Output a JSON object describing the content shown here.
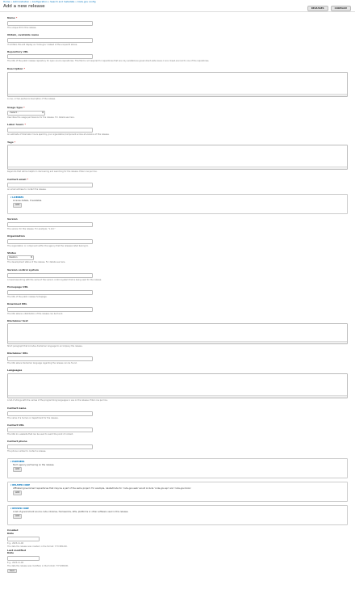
{
  "breadcrumb": "Home » Administration » Configuration » Search and metadata » Code.gov config",
  "page_title": "Add a new release",
  "actions": {
    "button_1": "RELEASES",
    "button_2": "CODEGOV"
  },
  "fields": {
    "name": {
      "label": "Name",
      "req": "*",
      "desc": "The unique ID for this release."
    },
    "vcs_id": {
      "label": "Obtain, available name",
      "desc": "If omitted, this will display an 'Code.gov' instead of the unique ID above."
    },
    "repo_url": {
      "label": "Repository URL",
      "desc": "The URL of the public release repository for open source repositories. This field is not required for repositories that are only available as government-wide reuse or are closed-sourced to one of the repositories."
    },
    "description": {
      "label": "Description",
      "req": "*",
      "desc": "A one- or two-sentence description of the release."
    },
    "usage_type": {
      "label": "Usage type",
      "req": "*",
      "value": "- Select -",
      "desc": "Describes the usage permissions for the release. For details see here."
    },
    "labor_hours": {
      "label": "Labor hours",
      "req": "*",
      "desc": "An estimate of total labor hours spent by your organization/component across all versions of this release."
    },
    "tags": {
      "label": "Tags",
      "req": "*",
      "desc": "Keywords that will be helpful in discovering and searching for the release. Enter one per line."
    },
    "contact_email": {
      "label": "Contact email",
      "req": "*",
      "desc": "An email address to contact the release."
    },
    "version": {
      "label": "Version",
      "desc": "The version for this release. For example, \"1.0.0.\""
    },
    "organization": {
      "label": "Organization",
      "desc": "The organization or component within the agency that the releases listed belong to."
    },
    "status": {
      "label": "Status",
      "value": "Ideation",
      "desc": "The development status of the release. For details see here."
    },
    "vcs": {
      "label": "Version control system",
      "desc": "A lowercase string with the name of the version control system that is being used for the release."
    },
    "homepage_url": {
      "label": "Homepage URL",
      "desc": "The URL of the public release homepage."
    },
    "download_url": {
      "label": "Download URL",
      "desc": "The URL where a distribution of the release can be found."
    },
    "disclaimer_text": {
      "label": "Disclaimer text",
      "desc": "Short paragraph that includes disclaimer language to accompany the release."
    },
    "disclaimer_url": {
      "label": "Disclaimer URL",
      "desc": "The URL where disclaimer language regarding the release can be found."
    },
    "languages": {
      "label": "Languages",
      "desc": "A list of strings with the names of the programming languages in use on the release. Enter one per line."
    },
    "contact_name": {
      "label": "Contact name",
      "desc": "The name of a human or department for the release."
    },
    "contact_url": {
      "label": "Contact URL",
      "desc": "The URL to a website that can be used to reach the point of contact."
    },
    "contact_phone": {
      "label": "Contact phone",
      "desc": "The phone number to contact a release."
    }
  },
  "fieldsets": {
    "licenses": {
      "legend": "LICENSES",
      "text": "License details, if available.",
      "button": "ADD"
    },
    "partners": {
      "legend": "PARTNERS",
      "text": "Each agency partnering on the release.",
      "button": "ADD"
    },
    "related_code": {
      "legend": "RELATED CODE",
      "text": "Affiliated government repositories that may be a part of the same project. For example, relatedCode for 'code-gov-web' would include 'code-gov-api' and 'code-gov-tools'.",
      "button": "ADD"
    },
    "reused_code": {
      "legend": "REUSED CODE",
      "text": "A list of government source code, libraries, frameworks, APIs, platforms or other software used in this release.",
      "button": "ADD"
    }
  },
  "dates": {
    "section": "Created",
    "created_label": "Date",
    "created_hint": "E.g., 2023-11-06",
    "created_desc": "The date the release was created, in the format: YYYY-MM-DD.",
    "modified_section": "Last modified",
    "modified_label": "Date",
    "modified_hint": "E.g., 2023-11-06",
    "modified_desc": "The date the release was modified, in the format: YYYY-MM-DD."
  },
  "save_label": "Save",
  "colors": {
    "link": "#0074bd",
    "required": "#cc0000"
  },
  "icons": {
    "select_arrow": "chevron-down-icon",
    "textarea_grip": "resize-grip-icon"
  }
}
